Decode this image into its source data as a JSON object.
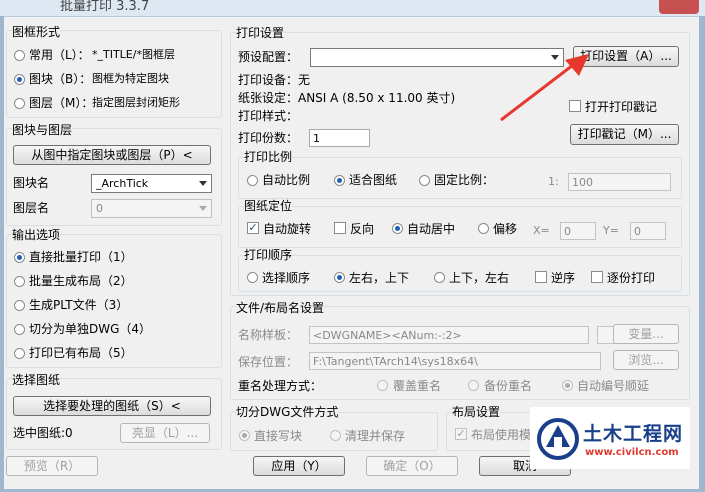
{
  "window": {
    "title": "批量打印 3.3.7"
  },
  "frame_style": {
    "title": "图框形式",
    "options": [
      {
        "label": "常用（L）：",
        "value": "*_TITLE/*图框层",
        "selected": false
      },
      {
        "label": "图块（B）：",
        "value": "图框为特定图块",
        "selected": true
      },
      {
        "label": "图层（M）：",
        "value": "指定图层封闭矩形",
        "selected": false
      }
    ]
  },
  "block_layer": {
    "title": "图块与图层",
    "pick_button": "从图中指定图块或图层（P）<",
    "block_label": "图块名",
    "block_value": "_ArchTick",
    "layer_label": "图层名",
    "layer_value": "0"
  },
  "output": {
    "title": "输出选项",
    "options": [
      {
        "label": "直接批量打印（1）",
        "selected": true
      },
      {
        "label": "批量生成布局（2）",
        "selected": false
      },
      {
        "label": "生成PLT文件（3）",
        "selected": false
      },
      {
        "label": "切分为单独DWG（4）",
        "selected": false
      },
      {
        "label": "打印已有布局（5）",
        "selected": false
      }
    ]
  },
  "select_sheets": {
    "title": "选择图纸",
    "button": "选择要处理的图纸（S）<",
    "selected_label": "选中图纸:0",
    "highlight_button": "亮显（L）..."
  },
  "print_settings": {
    "title": "打印设置",
    "preset_label": "预设配置：",
    "preset_value": "",
    "settings_button": "打印设置（A）...",
    "device_line": "打印设备：无",
    "paper_line": "纸张设定：ANSI A (8.50 x 11.00 英寸)",
    "style_line": "打印样式：",
    "stamp_checkbox": {
      "label": "打开打印戳记",
      "checked": false
    },
    "stamp_button": "打印戳记（M）...",
    "copies_label": "打印份数：",
    "copies_value": "1"
  },
  "scale": {
    "title": "打印比例",
    "options": [
      {
        "label": "自动比例",
        "selected": false
      },
      {
        "label": "适合图纸",
        "selected": true
      },
      {
        "label": "固定比例：",
        "selected": false
      }
    ],
    "ratio_prefix": "1:",
    "ratio_value": "100"
  },
  "position": {
    "title": "图纸定位",
    "auto_rotate": {
      "label": "自动旋转",
      "checked": true
    },
    "reverse": {
      "label": "反向",
      "checked": false
    },
    "center": {
      "label": "自动居中",
      "selected": true
    },
    "offset": {
      "label": "偏移",
      "selected": false
    },
    "x_label": "X=",
    "x_value": "0",
    "y_label": "Y=",
    "y_value": "0"
  },
  "order": {
    "title": "打印顺序",
    "options": [
      {
        "label": "选择顺序",
        "selected": false
      },
      {
        "label": "左右，上下",
        "selected": true
      },
      {
        "label": "上下，左右",
        "selected": false
      }
    ],
    "reverse_order": {
      "label": "逆序",
      "checked": false
    },
    "copies_order": {
      "label": "逐份打印",
      "checked": false
    }
  },
  "file_layout": {
    "title": "文件/布局名设置",
    "name_label": "名称样板：",
    "name_value": "<DWGNAME><ANum:-:2>",
    "change_button": "变量...",
    "save_label": "保存位置：",
    "save_value": "F:\\Tangent\\TArch14\\sys18x64\\",
    "browse_button": "浏览...",
    "rename_label": "重名处理方式：",
    "rename_options": [
      {
        "label": "覆盖重名",
        "selected": false
      },
      {
        "label": "备份重名",
        "selected": false
      },
      {
        "label": "自动编号顺延",
        "selected": true
      }
    ]
  },
  "split_dwg": {
    "title": "切分DWG文件方式",
    "options": [
      {
        "label": "直接写块",
        "selected": true
      },
      {
        "label": "清理并保存",
        "selected": false
      }
    ]
  },
  "layout_settings": {
    "title": "布局设置",
    "use_template": {
      "label": "布局使用模",
      "checked": true
    }
  },
  "footer": {
    "preview": "预览（R）",
    "apply": "应用（Y）",
    "ok": "确定（O）",
    "cancel": "取消"
  },
  "watermark": {
    "name": "土木工程网",
    "url": "www.civilcn.com"
  },
  "colors": {
    "accent": "#1f5fb5",
    "arrow": "#e8382e"
  }
}
